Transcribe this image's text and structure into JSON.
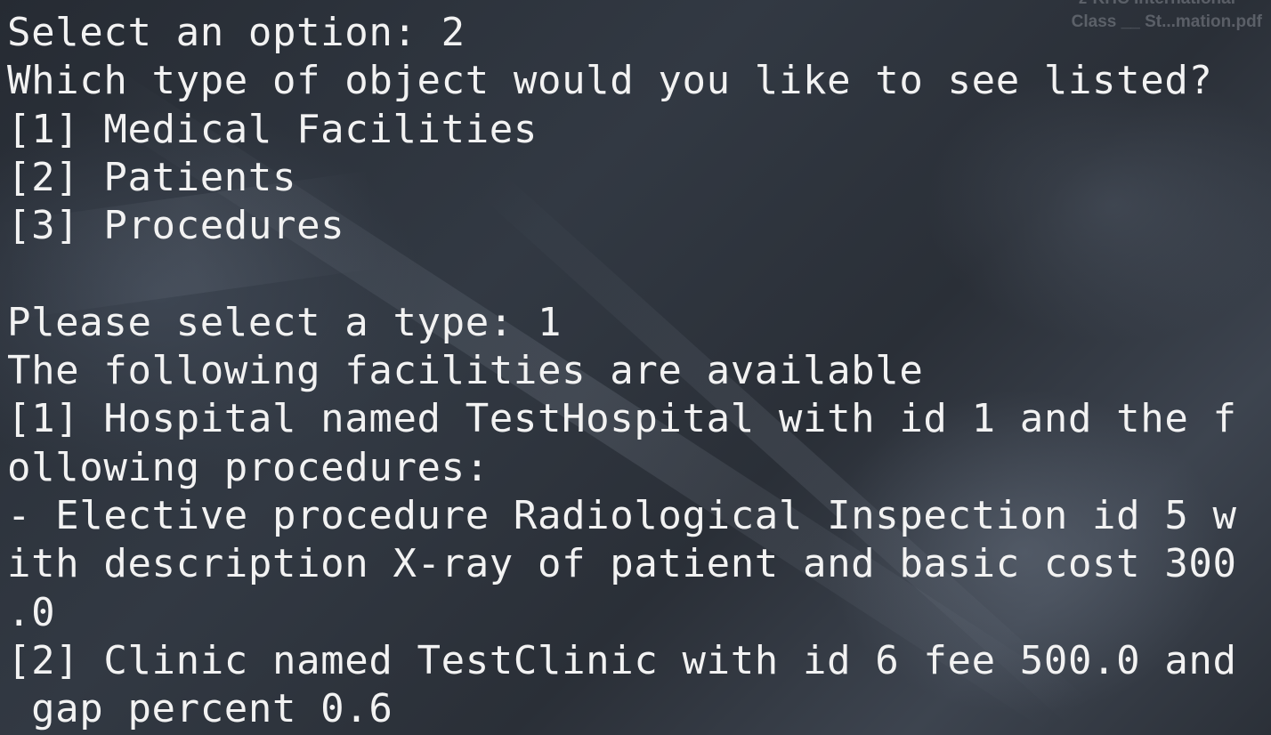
{
  "desktop": {
    "file_label_partial": "z-KHC International",
    "file_label": "Class __ St...mation.pdf"
  },
  "terminal": {
    "lines": [
      "Select an option: 2",
      "Which type of object would you like to see listed?",
      "[1] Medical Facilities",
      "[2] Patients",
      "[3] Procedures",
      "",
      "Please select a type: 1",
      "The following facilities are available",
      "[1] Hospital named TestHospital with id 1 and the f",
      "ollowing procedures:",
      "- Elective procedure Radiological Inspection id 5 w",
      "ith description X-ray of patient and basic cost 300",
      ".0",
      "[2] Clinic named TestClinic with id 6 fee 500.0 and",
      " gap percent 0.6"
    ]
  }
}
